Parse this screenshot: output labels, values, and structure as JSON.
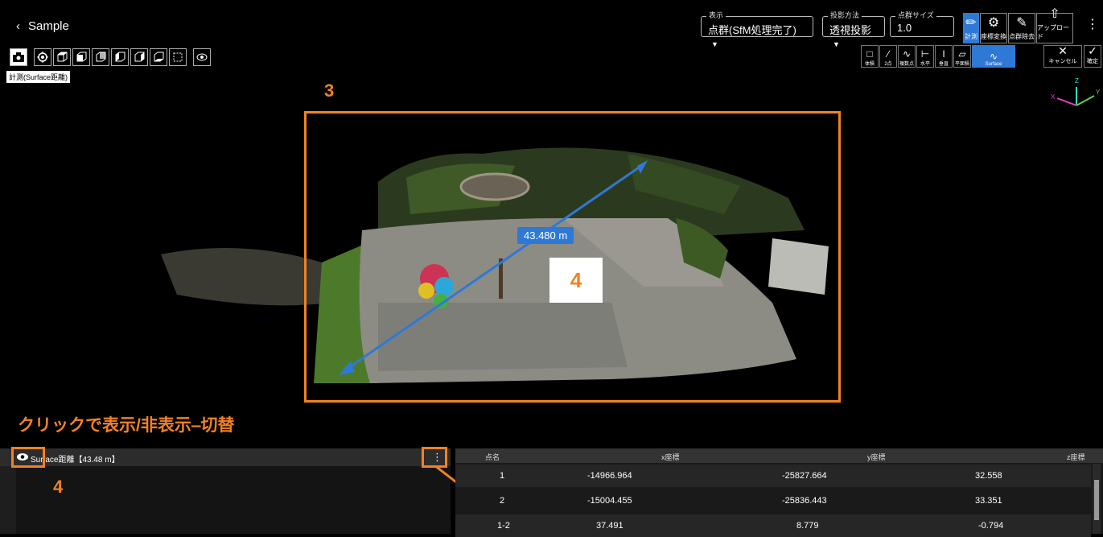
{
  "header": {
    "back_label": "Sample",
    "display_mode": {
      "legend": "表示",
      "value": "点群(SfM処理完了)"
    },
    "projection": {
      "legend": "投影方法",
      "value": "透視投影"
    },
    "point_size": {
      "legend": "点群サイズ",
      "value": "1.0"
    },
    "tools": [
      {
        "label": "計測",
        "icon": "ruler-icon",
        "active": true
      },
      {
        "label": "座標変換",
        "icon": "coordinate-icon",
        "active": false
      },
      {
        "label": "点群除去",
        "icon": "eraser-icon",
        "active": false
      },
      {
        "label": "アップロード",
        "icon": "upload-icon",
        "active": false
      }
    ]
  },
  "view_tools": {
    "buttons": [
      "camera-icon",
      "target-icon",
      "cube-top-icon",
      "cube-front-icon",
      "cube-back-icon",
      "cube-left-icon",
      "cube-right-icon",
      "cube-bottom-icon",
      "square-dashed-icon",
      "eye-icon"
    ],
    "tooltip": "計測(Surface距離)"
  },
  "measure_tools": {
    "items": [
      {
        "label": "体積",
        "icon": "volume-icon",
        "active": false
      },
      {
        "label": "2点",
        "icon": "two-point-icon",
        "active": false
      },
      {
        "label": "複数点",
        "icon": "multi-point-icon",
        "active": false
      },
      {
        "label": "水平",
        "icon": "horizontal-icon",
        "active": false
      },
      {
        "label": "垂直",
        "icon": "vertical-icon",
        "active": false
      },
      {
        "label": "平面積",
        "icon": "area-icon",
        "active": false
      },
      {
        "label": "Surface",
        "icon": "surface-icon",
        "active": true
      }
    ],
    "cancel_label": "キャンセル",
    "confirm_label": "確定"
  },
  "axis": {
    "x": "X",
    "y": "Y",
    "z": "Z"
  },
  "viewport": {
    "distance_label": "43.480 m"
  },
  "annotations": {
    "num_3": "3",
    "num_4_center": "4",
    "num_4_panel": "4",
    "caption": "クリックで表示/非表示‒切替"
  },
  "layer_panel": {
    "layer_name": "Surface距離【43.48 m】"
  },
  "table": {
    "columns": [
      "点名",
      "x座標",
      "y座標",
      "z座標"
    ],
    "rows": [
      {
        "name": "1",
        "x": "-14966.964",
        "y": "-25827.664",
        "z": "32.558"
      },
      {
        "name": "2",
        "x": "-15004.455",
        "y": "-25836.443",
        "z": "33.351"
      },
      {
        "name": "1-2",
        "x": "37.491",
        "y": "8.779",
        "z": "-0.794"
      }
    ]
  },
  "colors": {
    "accent": "#2e79d6",
    "annotation": "#f08224",
    "background": "#000000"
  }
}
